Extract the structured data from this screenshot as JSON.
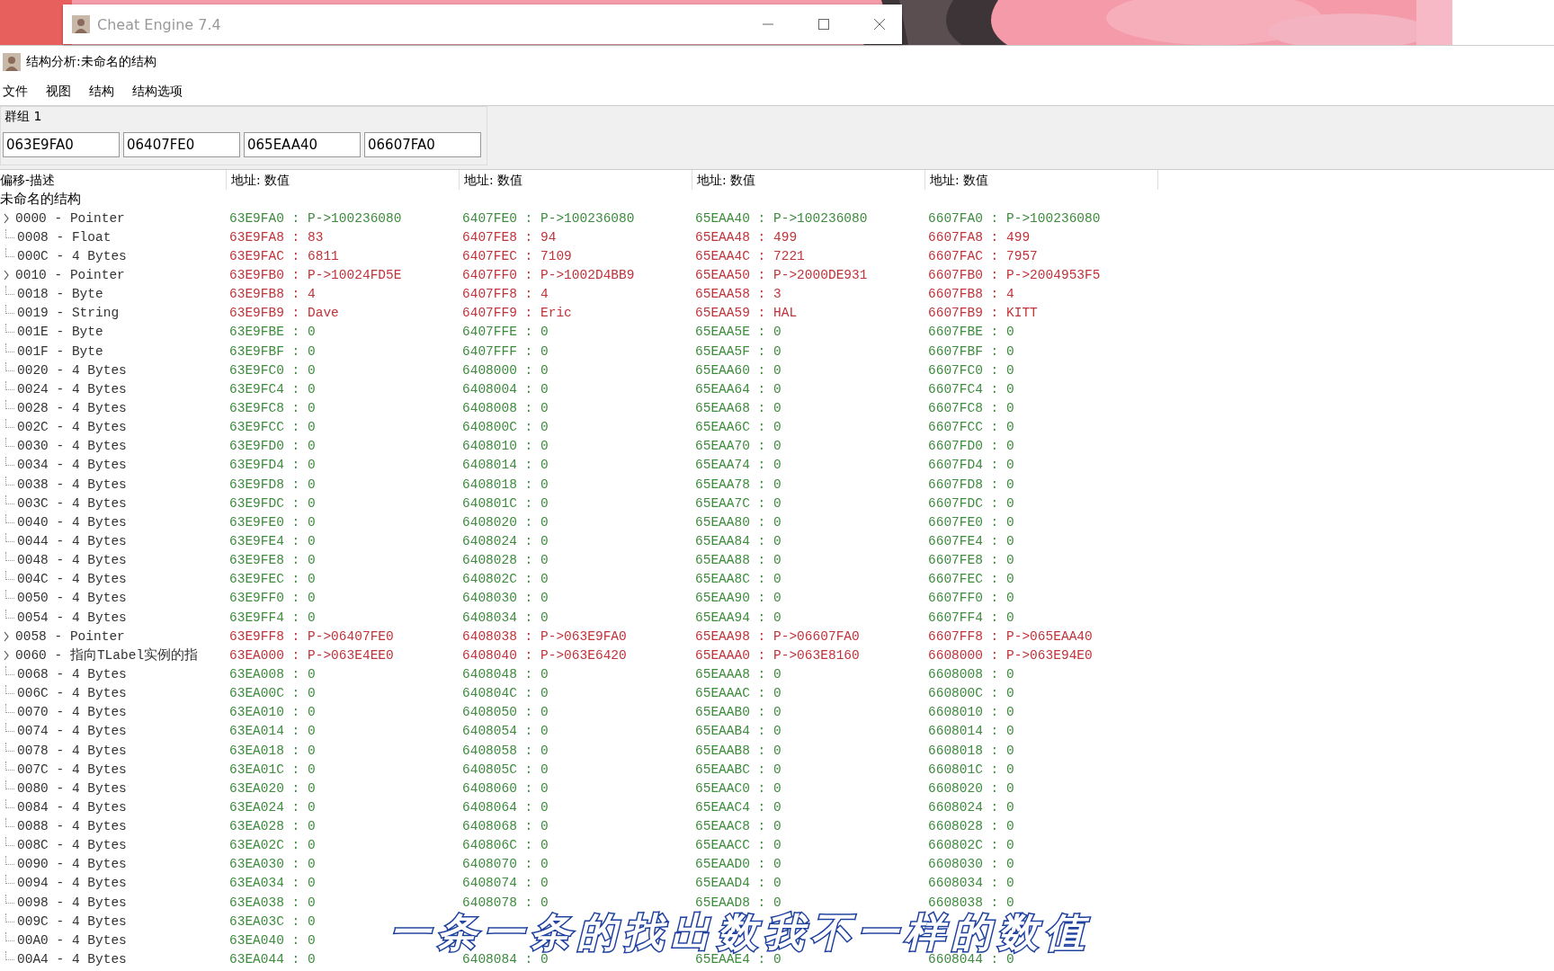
{
  "background_window": {
    "title": "Cheat Engine 7.4"
  },
  "window": {
    "title": "结构分析:未命名的结构"
  },
  "menu": [
    "文件",
    "视图",
    "结构",
    "结构选项"
  ],
  "group": {
    "label": "群组 1",
    "addresses": [
      "063E9FA0",
      "06407FE0",
      "065EAA40",
      "06607FA0"
    ]
  },
  "columns": [
    "偏移-描述",
    "地址: 数值",
    "地址: 数值",
    "地址: 数值",
    "地址: 数值"
  ],
  "root": "未命名的结构",
  "rows": [
    {
      "desc": "0000 - Pointer",
      "expandable": true,
      "differs": false,
      "cells": [
        "63E9FA0 : P->100236080",
        "6407FE0 : P->100236080",
        "65EAA40 : P->100236080",
        "6607FA0 : P->100236080"
      ]
    },
    {
      "desc": "0008 - Float",
      "expandable": false,
      "differs": true,
      "cells": [
        "63E9FA8 : 83",
        "6407FE8 : 94",
        "65EAA48 : 499",
        "6607FA8 : 499"
      ]
    },
    {
      "desc": "000C - 4 Bytes",
      "expandable": false,
      "differs": true,
      "cells": [
        "63E9FAC : 6811",
        "6407FEC : 7109",
        "65EAA4C : 7221",
        "6607FAC : 7957"
      ]
    },
    {
      "desc": "0010 - Pointer",
      "expandable": true,
      "differs": true,
      "cells": [
        "63E9FB0 : P->10024FD5E",
        "6407FF0 : P->1002D4BB9",
        "65EAA50 : P->2000DE931",
        "6607FB0 : P->2004953F5"
      ]
    },
    {
      "desc": "0018 - Byte",
      "expandable": false,
      "differs": true,
      "cells": [
        "63E9FB8 : 4",
        "6407FF8 : 4",
        "65EAA58 : 3",
        "6607FB8 : 4"
      ]
    },
    {
      "desc": "0019 - String",
      "expandable": false,
      "differs": true,
      "cells": [
        "63E9FB9 : Dave",
        "6407FF9 : Eric",
        "65EAA59 : HAL",
        "6607FB9 : KITT"
      ]
    },
    {
      "desc": "001E - Byte",
      "expandable": false,
      "differs": false,
      "cells": [
        "63E9FBE : 0",
        "6407FFE : 0",
        "65EAA5E : 0",
        "6607FBE : 0"
      ]
    },
    {
      "desc": "001F - Byte",
      "expandable": false,
      "differs": false,
      "cells": [
        "63E9FBF : 0",
        "6407FFF : 0",
        "65EAA5F : 0",
        "6607FBF : 0"
      ]
    },
    {
      "desc": "0020 - 4 Bytes",
      "expandable": false,
      "differs": false,
      "cells": [
        "63E9FC0 : 0",
        "6408000 : 0",
        "65EAA60 : 0",
        "6607FC0 : 0"
      ]
    },
    {
      "desc": "0024 - 4 Bytes",
      "expandable": false,
      "differs": false,
      "cells": [
        "63E9FC4 : 0",
        "6408004 : 0",
        "65EAA64 : 0",
        "6607FC4 : 0"
      ]
    },
    {
      "desc": "0028 - 4 Bytes",
      "expandable": false,
      "differs": false,
      "cells": [
        "63E9FC8 : 0",
        "6408008 : 0",
        "65EAA68 : 0",
        "6607FC8 : 0"
      ]
    },
    {
      "desc": "002C - 4 Bytes",
      "expandable": false,
      "differs": false,
      "cells": [
        "63E9FCC : 0",
        "640800C : 0",
        "65EAA6C : 0",
        "6607FCC : 0"
      ]
    },
    {
      "desc": "0030 - 4 Bytes",
      "expandable": false,
      "differs": false,
      "cells": [
        "63E9FD0 : 0",
        "6408010 : 0",
        "65EAA70 : 0",
        "6607FD0 : 0"
      ]
    },
    {
      "desc": "0034 - 4 Bytes",
      "expandable": false,
      "differs": false,
      "cells": [
        "63E9FD4 : 0",
        "6408014 : 0",
        "65EAA74 : 0",
        "6607FD4 : 0"
      ]
    },
    {
      "desc": "0038 - 4 Bytes",
      "expandable": false,
      "differs": false,
      "cells": [
        "63E9FD8 : 0",
        "6408018 : 0",
        "65EAA78 : 0",
        "6607FD8 : 0"
      ]
    },
    {
      "desc": "003C - 4 Bytes",
      "expandable": false,
      "differs": false,
      "cells": [
        "63E9FDC : 0",
        "640801C : 0",
        "65EAA7C : 0",
        "6607FDC : 0"
      ]
    },
    {
      "desc": "0040 - 4 Bytes",
      "expandable": false,
      "differs": false,
      "cells": [
        "63E9FE0 : 0",
        "6408020 : 0",
        "65EAA80 : 0",
        "6607FE0 : 0"
      ]
    },
    {
      "desc": "0044 - 4 Bytes",
      "expandable": false,
      "differs": false,
      "cells": [
        "63E9FE4 : 0",
        "6408024 : 0",
        "65EAA84 : 0",
        "6607FE4 : 0"
      ]
    },
    {
      "desc": "0048 - 4 Bytes",
      "expandable": false,
      "differs": false,
      "cells": [
        "63E9FE8 : 0",
        "6408028 : 0",
        "65EAA88 : 0",
        "6607FE8 : 0"
      ]
    },
    {
      "desc": "004C - 4 Bytes",
      "expandable": false,
      "differs": false,
      "cells": [
        "63E9FEC : 0",
        "640802C : 0",
        "65EAA8C : 0",
        "6607FEC : 0"
      ]
    },
    {
      "desc": "0050 - 4 Bytes",
      "expandable": false,
      "differs": false,
      "cells": [
        "63E9FF0 : 0",
        "6408030 : 0",
        "65EAA90 : 0",
        "6607FF0 : 0"
      ]
    },
    {
      "desc": "0054 - 4 Bytes",
      "expandable": false,
      "differs": false,
      "cells": [
        "63E9FF4 : 0",
        "6408034 : 0",
        "65EAA94 : 0",
        "6607FF4 : 0"
      ]
    },
    {
      "desc": "0058 - Pointer",
      "expandable": true,
      "differs": true,
      "cells": [
        "63E9FF8 : P->06407FE0",
        "6408038 : P->063E9FA0",
        "65EAA98 : P->06607FA0",
        "6607FF8 : P->065EAA40"
      ]
    },
    {
      "desc": "0060 - 指向TLabel实例的指",
      "expandable": true,
      "differs": true,
      "cells": [
        "63EA000 : P->063E4EE0",
        "6408040 : P->063E6420",
        "65EAAA0 : P->063E8160",
        "6608000 : P->063E94E0"
      ]
    },
    {
      "desc": "0068 - 4 Bytes",
      "expandable": false,
      "differs": false,
      "cells": [
        "63EA008 : 0",
        "6408048 : 0",
        "65EAAA8 : 0",
        "6608008 : 0"
      ]
    },
    {
      "desc": "006C - 4 Bytes",
      "expandable": false,
      "differs": false,
      "cells": [
        "63EA00C : 0",
        "640804C : 0",
        "65EAAAC : 0",
        "660800C : 0"
      ]
    },
    {
      "desc": "0070 - 4 Bytes",
      "expandable": false,
      "differs": false,
      "cells": [
        "63EA010 : 0",
        "6408050 : 0",
        "65EAAB0 : 0",
        "6608010 : 0"
      ]
    },
    {
      "desc": "0074 - 4 Bytes",
      "expandable": false,
      "differs": false,
      "cells": [
        "63EA014 : 0",
        "6408054 : 0",
        "65EAAB4 : 0",
        "6608014 : 0"
      ]
    },
    {
      "desc": "0078 - 4 Bytes",
      "expandable": false,
      "differs": false,
      "cells": [
        "63EA018 : 0",
        "6408058 : 0",
        "65EAAB8 : 0",
        "6608018 : 0"
      ]
    },
    {
      "desc": "007C - 4 Bytes",
      "expandable": false,
      "differs": false,
      "cells": [
        "63EA01C : 0",
        "640805C : 0",
        "65EAABC : 0",
        "660801C : 0"
      ]
    },
    {
      "desc": "0080 - 4 Bytes",
      "expandable": false,
      "differs": false,
      "cells": [
        "63EA020 : 0",
        "6408060 : 0",
        "65EAAC0 : 0",
        "6608020 : 0"
      ]
    },
    {
      "desc": "0084 - 4 Bytes",
      "expandable": false,
      "differs": false,
      "cells": [
        "63EA024 : 0",
        "6408064 : 0",
        "65EAAC4 : 0",
        "6608024 : 0"
      ]
    },
    {
      "desc": "0088 - 4 Bytes",
      "expandable": false,
      "differs": false,
      "cells": [
        "63EA028 : 0",
        "6408068 : 0",
        "65EAAC8 : 0",
        "6608028 : 0"
      ]
    },
    {
      "desc": "008C - 4 Bytes",
      "expandable": false,
      "differs": false,
      "cells": [
        "63EA02C : 0",
        "640806C : 0",
        "65EAACC : 0",
        "660802C : 0"
      ]
    },
    {
      "desc": "0090 - 4 Bytes",
      "expandable": false,
      "differs": false,
      "cells": [
        "63EA030 : 0",
        "6408070 : 0",
        "65EAAD0 : 0",
        "6608030 : 0"
      ]
    },
    {
      "desc": "0094 - 4 Bytes",
      "expandable": false,
      "differs": false,
      "cells": [
        "63EA034 : 0",
        "6408074 : 0",
        "65EAAD4 : 0",
        "6608034 : 0"
      ]
    },
    {
      "desc": "0098 - 4 Bytes",
      "expandable": false,
      "differs": false,
      "cells": [
        "63EA038 : 0",
        "6408078 : 0",
        "65EAAD8 : 0",
        "6608038 : 0"
      ]
    },
    {
      "desc": "009C - 4 Bytes",
      "expandable": false,
      "differs": false,
      "cells": [
        "63EA03C : 0"
      ]
    },
    {
      "desc": "00A0 - 4 Bytes",
      "expandable": false,
      "differs": false,
      "cells": [
        "63EA040 : 0"
      ]
    },
    {
      "desc": "00A4 - 4 Bytes",
      "expandable": false,
      "differs": false,
      "cells": [
        "63EA044 : 0",
        "6408084 : 0",
        "65EAAE4 : 0",
        "6608044 : 0"
      ]
    }
  ],
  "subtitle": "一条一条的找出数我不一样的数值"
}
